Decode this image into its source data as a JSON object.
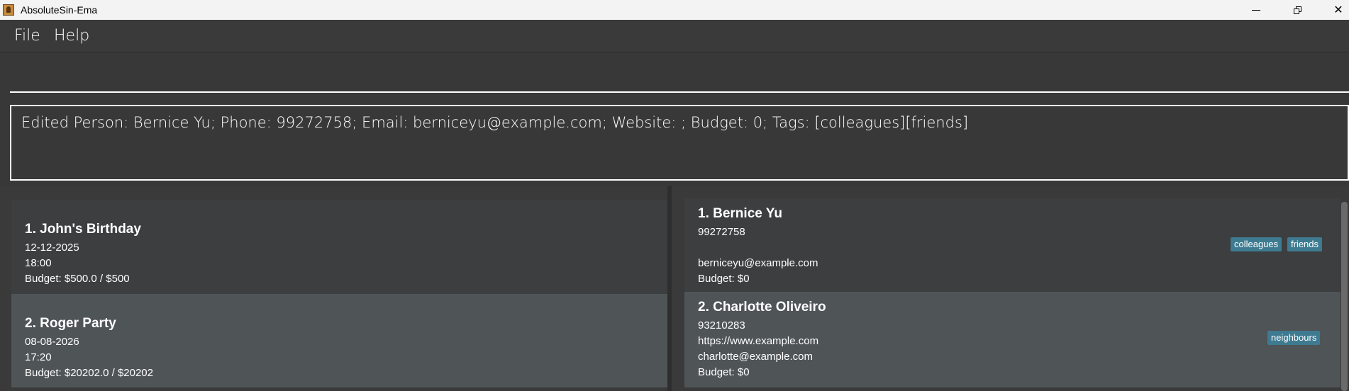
{
  "window": {
    "title": "AbsoluteSin-Ema"
  },
  "menu": {
    "file": "File",
    "help": "Help"
  },
  "command": {
    "value": "",
    "placeholder": ""
  },
  "result": {
    "message": "Edited Person: Bernice Yu; Phone: 99272758; Email: berniceyu@example.com; Website: ; Budget: 0; Tags: [colleagues][friends]"
  },
  "events": [
    {
      "title": "1. John's Birthday",
      "date": "12-12-2025",
      "time": "18:00",
      "budget": "Budget: $500.0 / $500"
    },
    {
      "title": "2. Roger Party",
      "date": "08-08-2026",
      "time": "17:20",
      "budget": "Budget: $20202.0 / $20202"
    }
  ],
  "persons": [
    {
      "name": "1. Bernice Yu",
      "phone": "99272758",
      "website": "",
      "email": "berniceyu@example.com",
      "budget": "Budget: $0",
      "tags": [
        "colleagues",
        "friends"
      ]
    },
    {
      "name": "2. Charlotte Oliveiro",
      "phone": "93210283",
      "website": "https://www.example.com",
      "email": "charlotte@example.com",
      "budget": "Budget: $0",
      "tags": [
        "neighbours"
      ]
    }
  ],
  "colors": {
    "background": "#383838",
    "selected_card": "#4f5457",
    "card": "#3c3e3f",
    "tag": "#3e7b91"
  }
}
